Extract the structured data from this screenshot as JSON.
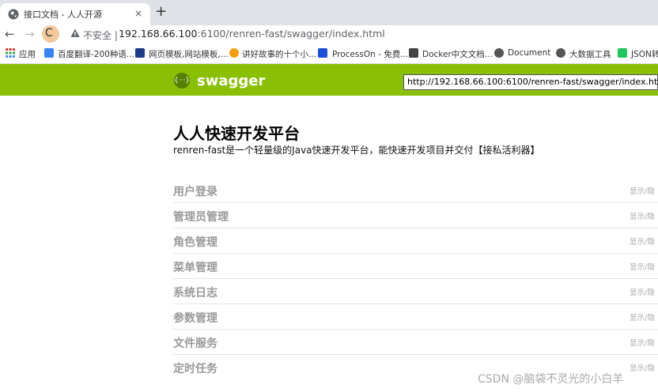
{
  "tab": {
    "title": "接口文档 - 人人开源",
    "close": "×",
    "new_tab": "+"
  },
  "toolbar": {
    "back": "←",
    "forward": "→",
    "reload": "C",
    "insecure_label": "不安全 |",
    "url_host": "192.168.66.100",
    "url_rest": ":6100/renren-fast/swagger/index.html"
  },
  "bookmarks": [
    {
      "label": "应用",
      "color": "#d93025"
    },
    {
      "label": "百度翻译-200种语...",
      "color": "#3b82f6"
    },
    {
      "label": "网页模板,网站模板,...",
      "color": "#1e3a8a"
    },
    {
      "label": "讲好故事的十个小...",
      "color": "#f59e0b"
    },
    {
      "label": "ProcessOn - 免费...",
      "color": "#1d4ed8"
    },
    {
      "label": "Docker中文文档...",
      "color": "#444444"
    },
    {
      "label": "Document",
      "color": "#555555"
    },
    {
      "label": "大数据工具",
      "color": "#555555"
    },
    {
      "label": "JSON转",
      "color": "#22c55e"
    }
  ],
  "swagger": {
    "logo_glyph": "{···}",
    "logo_text": "swagger",
    "api_url": "http://192.168.66.100:6100/renren-fast/swagger/index.html/../in",
    "brand_color": "#89bf04"
  },
  "page": {
    "title": "人人快速开发平台",
    "description": "renren-fast是一个轻量级的Java快速开发平台，能快速开发项目并交付【接私活利器】"
  },
  "resources": [
    {
      "name": "用户登录",
      "toggle": "显示/隐"
    },
    {
      "name": "管理员管理",
      "toggle": "显示/隐"
    },
    {
      "name": "角色管理",
      "toggle": "显示/隐"
    },
    {
      "name": "菜单管理",
      "toggle": "显示/隐"
    },
    {
      "name": "系统日志",
      "toggle": "显示/隐"
    },
    {
      "name": "参数管理",
      "toggle": "显示/隐"
    },
    {
      "name": "文件服务",
      "toggle": "显示/隐"
    },
    {
      "name": "定时任务",
      "toggle": "显示/隐"
    }
  ],
  "watermark": "CSDN @脑袋不灵光的小白羊"
}
